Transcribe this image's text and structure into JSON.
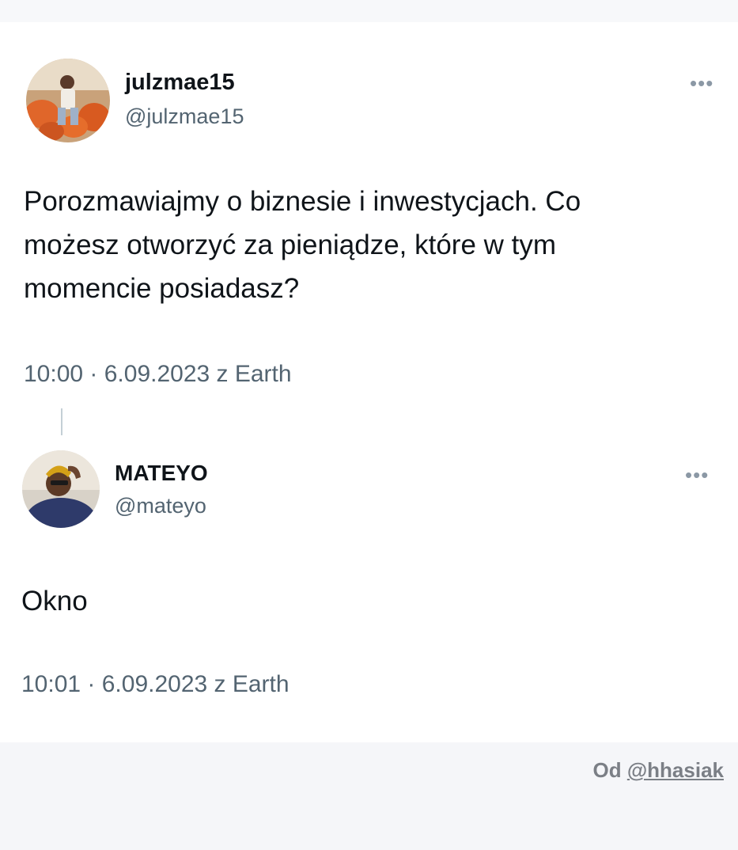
{
  "tweet1": {
    "display_name": "julzmae15",
    "handle": "@julzmae15",
    "text_lines": [
      "Porozmawiajmy o biznesie i inwestycjach. Co",
      "możesz otworzyć za pieniądze, które w tym",
      "momencie posiadasz?"
    ],
    "timestamp": "10:00 · 6.09.2023 z Earth",
    "more_label": "•••"
  },
  "tweet2": {
    "display_name": "MATEYO",
    "handle": "@mateyo",
    "text": "Okno",
    "timestamp": "10:01 · 6.09.2023 z Earth",
    "more_label": "•••"
  },
  "credit": {
    "prefix": "Od ",
    "user": "@hhasiak"
  }
}
